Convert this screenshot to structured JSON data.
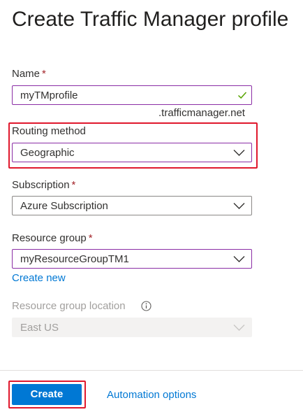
{
  "page_title": "Create Traffic Manager profile",
  "fields": {
    "name": {
      "label": "Name",
      "required_mark": "*",
      "value": "myTMprofile",
      "suffix": ".trafficmanager.net"
    },
    "routing_method": {
      "label": "Routing method",
      "value": "Geographic"
    },
    "subscription": {
      "label": "Subscription",
      "required_mark": "*",
      "value": "Azure Subscription"
    },
    "resource_group": {
      "label": "Resource group",
      "required_mark": "*",
      "value": "myResourceGroupTM1",
      "create_new": "Create new"
    },
    "resource_group_location": {
      "label": "Resource group location",
      "value": "East US"
    }
  },
  "footer": {
    "create_label": "Create",
    "automation_label": "Automation options"
  },
  "colors": {
    "accent": "#0078d4",
    "focus_border": "#8a2da5",
    "highlight": "#e0182d",
    "required": "#a4262c",
    "valid_check": "#57a300",
    "disabled_text": "#a19f9d"
  },
  "icons": {
    "valid": "checkmark-icon",
    "dropdown": "chevron-down-icon",
    "info": "info-icon"
  }
}
